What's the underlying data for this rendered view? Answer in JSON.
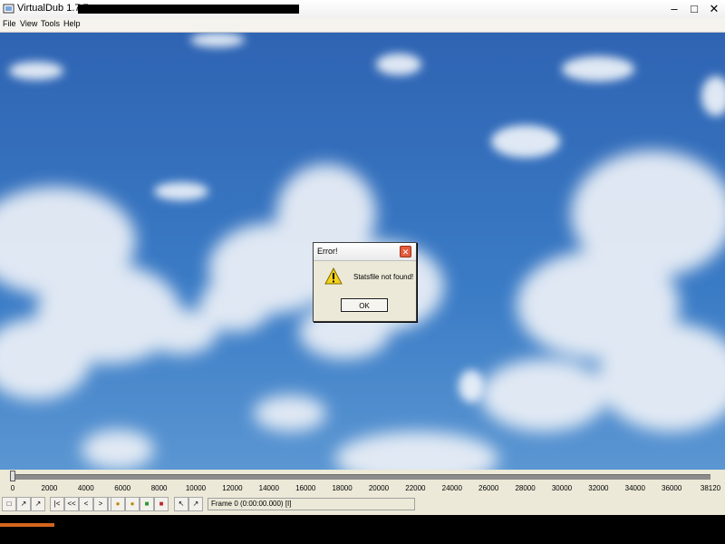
{
  "window": {
    "title": "VirtualDub 1.7.7 -",
    "controls": {
      "minimize": "–",
      "maximize": "□",
      "close": "✕"
    }
  },
  "menu": [
    "File",
    "View",
    "Tools",
    "Help"
  ],
  "dialog": {
    "title": "Error!",
    "close": "✕",
    "message": "Statsfile not found!",
    "ok_label": "OK",
    "icon": "warning-icon"
  },
  "timeline": {
    "ticks": [
      "0",
      "2000",
      "4000",
      "6000",
      "8000",
      "10000",
      "12000",
      "14000",
      "16000",
      "18000",
      "20000",
      "22000",
      "24000",
      "26000",
      "28000",
      "30000",
      "32000",
      "34000",
      "36000",
      "38120"
    ],
    "position_frames": 0,
    "total_frames": 38120
  },
  "toolbar": {
    "buttons": [
      "stop-icon",
      "play-input-icon",
      "play-output-icon",
      "start-icon",
      "prev-keyframe-icon",
      "prev-frame-icon",
      "next-frame-icon",
      "end-icon",
      "prev-keyframe-icon",
      "next-keyframe-icon",
      "scene-back-icon",
      "scene-forward-icon",
      "mark-in-icon",
      "mark-out-icon"
    ],
    "frame_status": "Frame 0 (0:00:00.000) [I]"
  },
  "colors": {
    "accent": "#e25c3d",
    "taskbar": "#d4651e"
  }
}
